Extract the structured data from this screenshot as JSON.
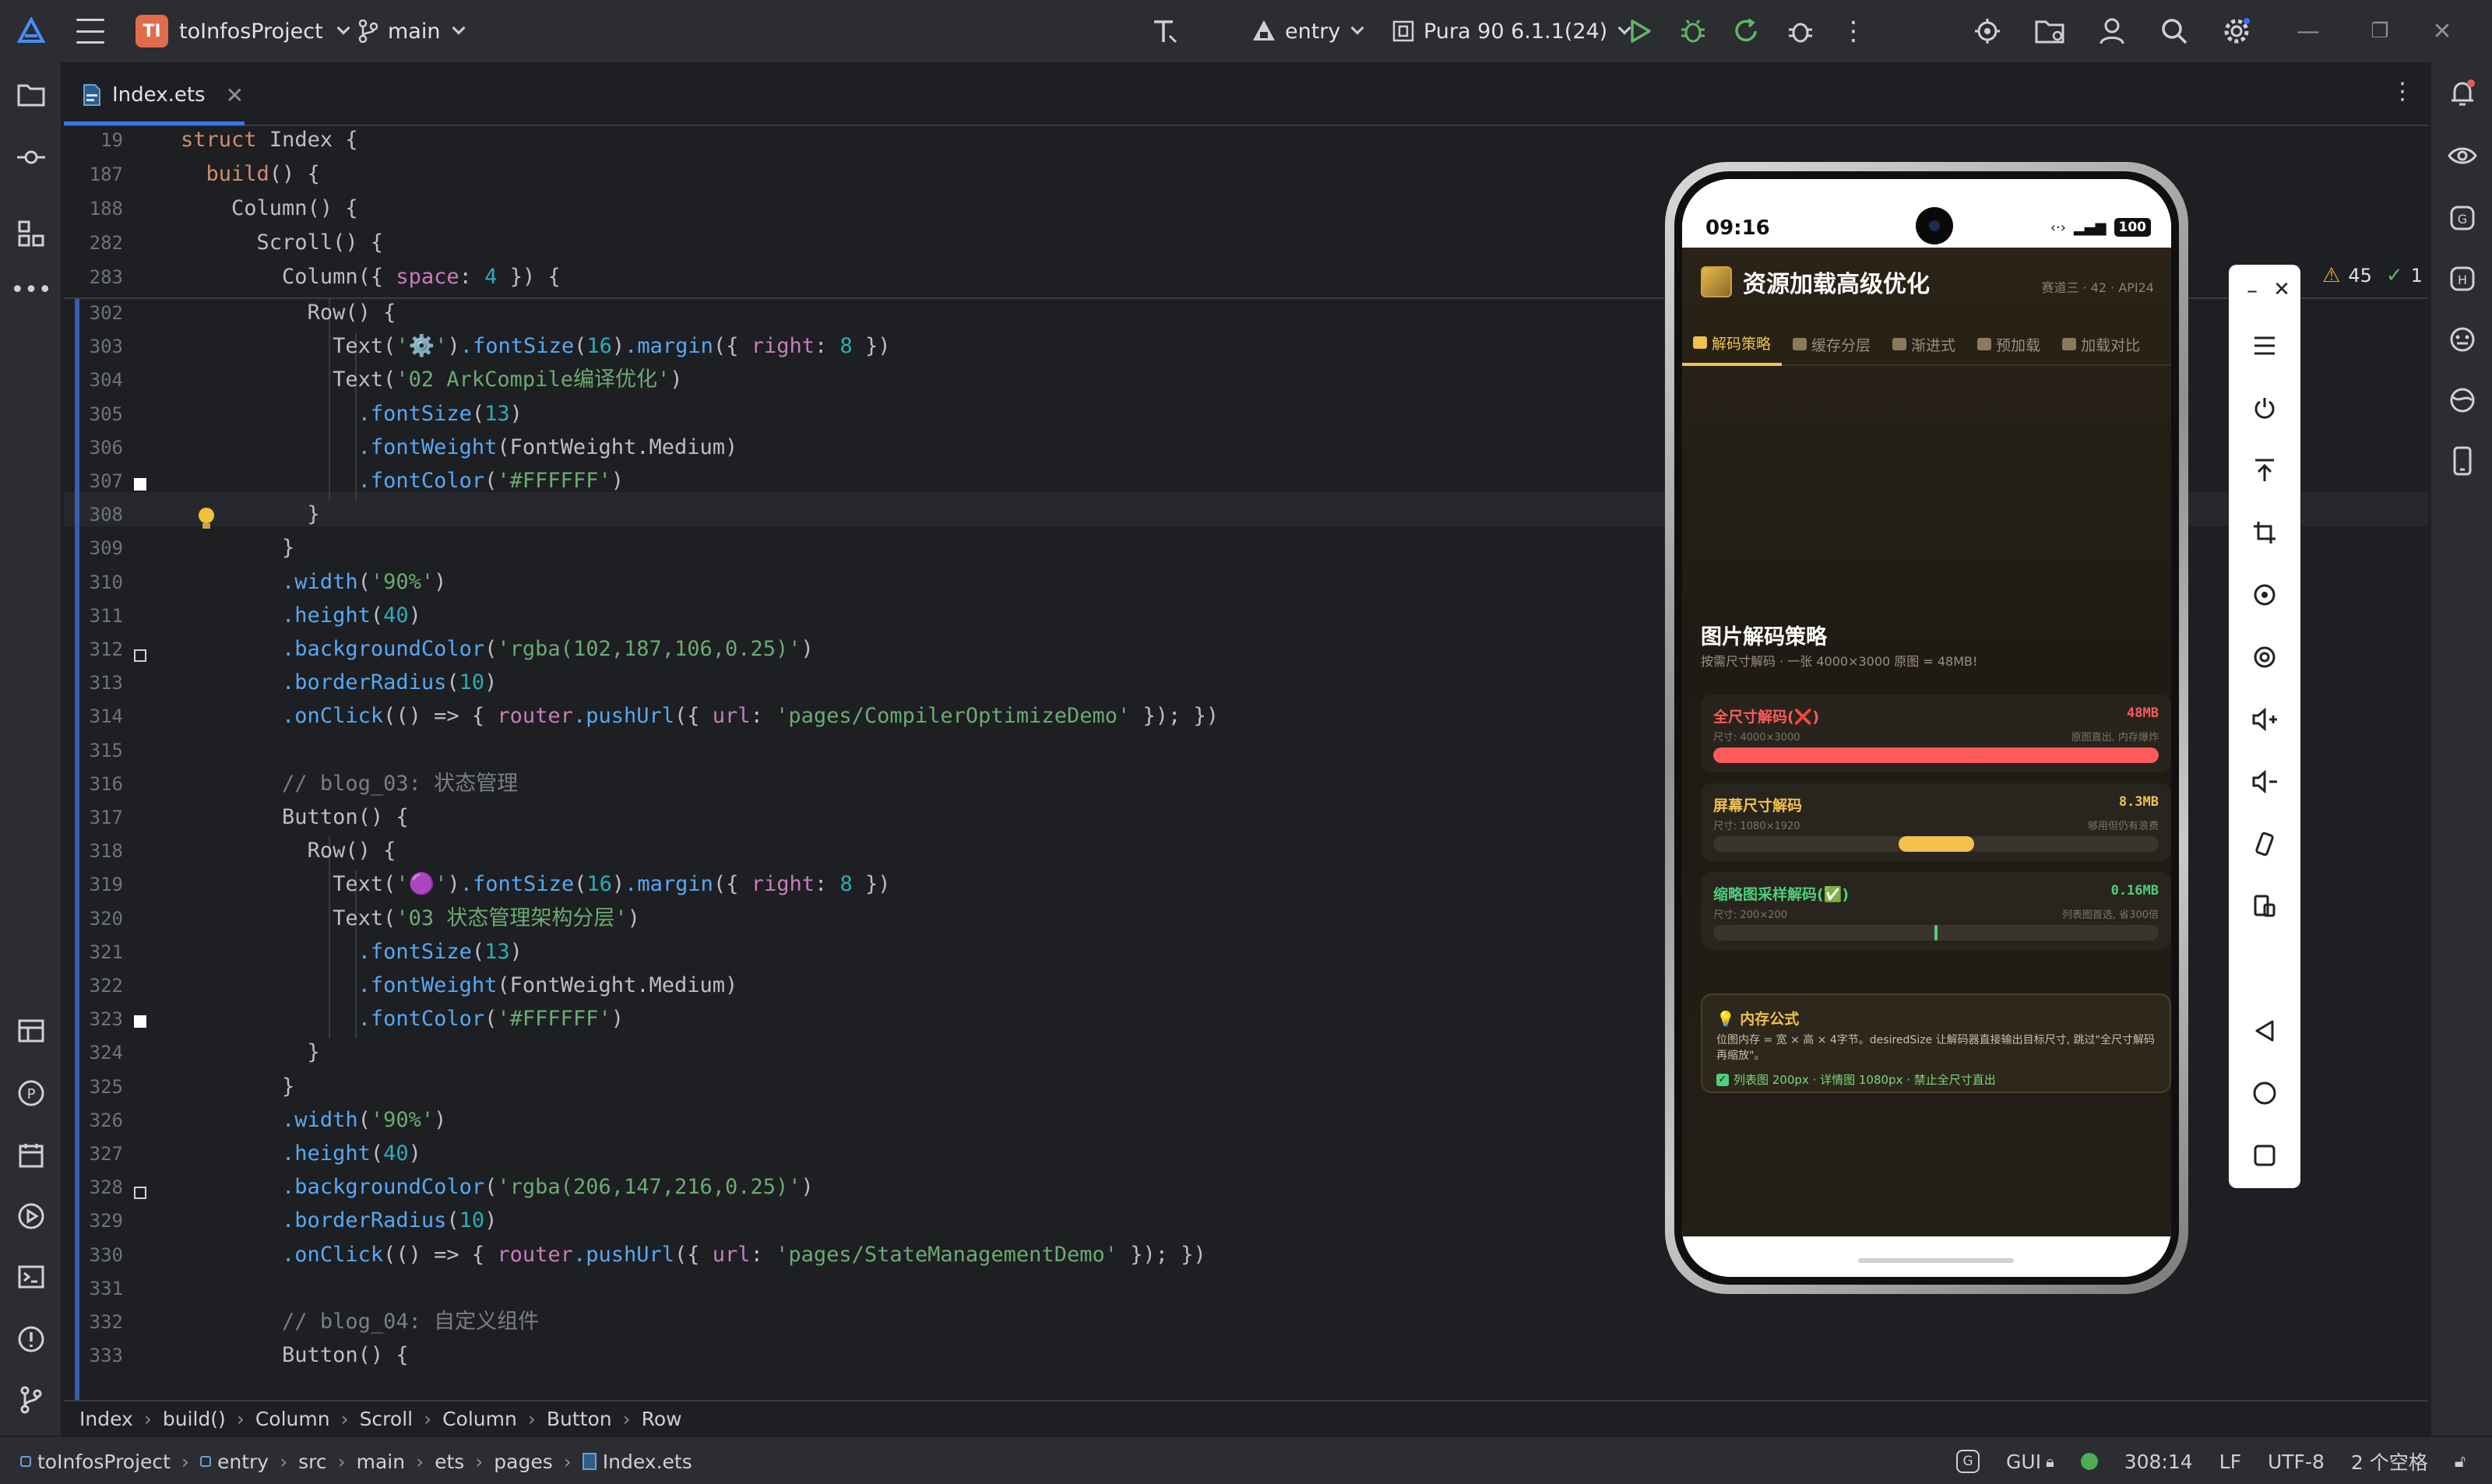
{
  "titlebar": {
    "project_badge": "TI",
    "project_name": "toInfosProject",
    "branch": "main",
    "run_config": "entry",
    "device": "Pura 90 6.1.1(24)"
  },
  "tab": {
    "file": "Index.ets"
  },
  "inspections": {
    "warnings": "45",
    "checks": "1"
  },
  "sticky_lines": [
    {
      "n": "19",
      "t": "struct Index {"
    },
    {
      "n": "187",
      "t": "  build() {"
    },
    {
      "n": "188",
      "t": "    Column() {"
    },
    {
      "n": "282",
      "t": "      Scroll() {"
    },
    {
      "n": "283",
      "t": "        Column({ space: 4 }) {"
    }
  ],
  "code_lines": [
    {
      "n": "302",
      "t": "          Row() {"
    },
    {
      "n": "303",
      "t": "            Text('⚙️').fontSize(16).margin({ right: 8 })"
    },
    {
      "n": "304",
      "t": "            Text('02 ArkCompile编译优化')"
    },
    {
      "n": "305",
      "t": "              .fontSize(13)"
    },
    {
      "n": "306",
      "t": "              .fontWeight(FontWeight.Medium)"
    },
    {
      "n": "307",
      "t": "              .fontColor('#FFFFFF')"
    },
    {
      "n": "308",
      "t": "          }"
    },
    {
      "n": "309",
      "t": "        }"
    },
    {
      "n": "310",
      "t": "        .width('90%')"
    },
    {
      "n": "311",
      "t": "        .height(40)"
    },
    {
      "n": "312",
      "t": "        .backgroundColor('rgba(102,187,106,0.25)')"
    },
    {
      "n": "313",
      "t": "        .borderRadius(10)"
    },
    {
      "n": "314",
      "t": "        .onClick(() => { router.pushUrl({ url: 'pages/CompilerOptimizeDemo' }); })"
    },
    {
      "n": "315",
      "t": ""
    },
    {
      "n": "316",
      "t": "        // blog_03: 状态管理"
    },
    {
      "n": "317",
      "t": "        Button() {"
    },
    {
      "n": "318",
      "t": "          Row() {"
    },
    {
      "n": "319",
      "t": "            Text('🟣').fontSize(16).margin({ right: 8 })"
    },
    {
      "n": "320",
      "t": "            Text('03 状态管理架构分层')"
    },
    {
      "n": "321",
      "t": "              .fontSize(13)"
    },
    {
      "n": "322",
      "t": "              .fontWeight(FontWeight.Medium)"
    },
    {
      "n": "323",
      "t": "              .fontColor('#FFFFFF')"
    },
    {
      "n": "324",
      "t": "          }"
    },
    {
      "n": "325",
      "t": "        }"
    },
    {
      "n": "326",
      "t": "        .width('90%')"
    },
    {
      "n": "327",
      "t": "        .height(40)"
    },
    {
      "n": "328",
      "t": "        .backgroundColor('rgba(206,147,216,0.25)')"
    },
    {
      "n": "329",
      "t": "        .borderRadius(10)"
    },
    {
      "n": "330",
      "t": "        .onClick(() => { router.pushUrl({ url: 'pages/StateManagementDemo' }); })"
    },
    {
      "n": "331",
      "t": ""
    },
    {
      "n": "332",
      "t": "        // blog_04: 自定义组件"
    },
    {
      "n": "333",
      "t": "        Button() {"
    }
  ],
  "breadcrumb": [
    "Index",
    "build()",
    "Column",
    "Scroll",
    "Column",
    "Button",
    "Row"
  ],
  "statusbar": {
    "path": [
      "toInfosProject",
      "entry",
      "src",
      "main",
      "ets",
      "pages",
      "Index.ets"
    ],
    "gui": "GUI",
    "position": "308:14",
    "line_sep": "LF",
    "encoding": "UTF-8",
    "indent": "2 个空格"
  },
  "phone": {
    "time": "09:16",
    "battery": "100",
    "app_title": "资源加载高级优化",
    "app_subtitle": "赛道三 · 42 · API24",
    "tabs": [
      "解码策略",
      "缓存分层",
      "渐进式",
      "预加载",
      "加载对比"
    ],
    "section_title": "图片解码策略",
    "section_sub": "按需尺寸解码 · 一张 4000×3000 原图 = 48MB!",
    "cards": [
      {
        "title": "全尺寸解码(❌)",
        "size": "尺寸: 4000×3000",
        "value": "48MB",
        "note": "原图直出, 内存爆炸",
        "color": "#ff5a5a",
        "fill": 1.0
      },
      {
        "title": "屏幕尺寸解码",
        "size": "尺寸: 1080×1920",
        "value": "8.3MB",
        "note": "够用但仍有浪费",
        "color": "#f2c14e",
        "fill": 0.17
      },
      {
        "title": "缩略图采样解码(✅)",
        "size": "尺寸: 200×200",
        "value": "0.16MB",
        "note": "列表图首选, 省300倍",
        "color": "#4cd07a",
        "fill": 0.003
      }
    ],
    "formula_title": "💡 内存公式",
    "formula_body": "位图内存 = 宽 × 高 × 4字节。desiredSize 让解码器直接输出目标尺寸, 跳过\"全尺寸解码再缩放\"。",
    "formula_tip": "列表图 200px · 详情图 1080px · 禁止全尺寸直出"
  }
}
